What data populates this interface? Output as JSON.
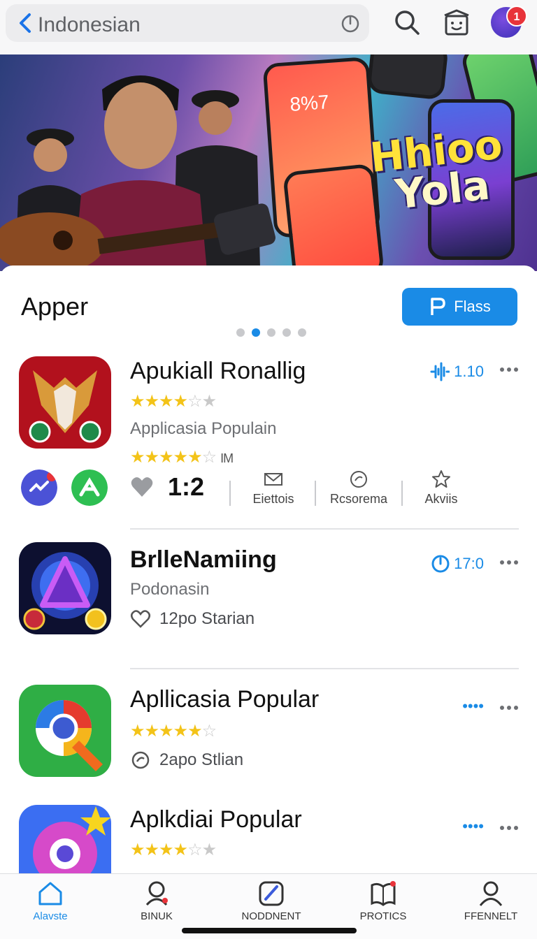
{
  "top_bar": {
    "search_text": "Indonesian",
    "avatar_badge": "1"
  },
  "banner": {
    "headline_line1": "Hhioo",
    "headline_line2": "Yola",
    "phone_time": "8%7"
  },
  "section": {
    "title": "Apper",
    "button_label": "Flass",
    "pager": {
      "count": 5,
      "active_index": 1
    }
  },
  "apps": [
    {
      "name": "Apukiall Ronallig",
      "rating_stars": 4,
      "subtitle": "Applicasia Populain",
      "second_rating_stars": 4.5,
      "second_rating_suffix": "IM",
      "meta_value": "1.10",
      "count": "1:2",
      "actions": [
        "Eiettois",
        "Rcsorema",
        "Akviis"
      ]
    },
    {
      "name": "BrlleNamiing",
      "subtitle": "Podonasin",
      "meta_value": "17:0",
      "detail": "12po Starian"
    },
    {
      "name": "Apllicasia Popular",
      "rating_stars": 4.5,
      "meta_value": "••••",
      "detail": "2apo Stlian"
    },
    {
      "name": "Aplkdiai Popular",
      "rating_stars": 4,
      "meta_value": "••••"
    }
  ],
  "tabs": [
    {
      "label": "Alavste",
      "icon": "home-icon",
      "active": true
    },
    {
      "label": "BINUK",
      "icon": "person-search-icon",
      "active": false
    },
    {
      "label": "NODDNENT",
      "icon": "edit-icon",
      "active": false
    },
    {
      "label": "PROTICS",
      "icon": "book-icon",
      "active": false
    },
    {
      "label": "FFENNELT",
      "icon": "profile-icon",
      "active": false
    }
  ],
  "colors": {
    "accent": "#1a8be6",
    "star": "#f3c318",
    "badge": "#e8333a"
  }
}
